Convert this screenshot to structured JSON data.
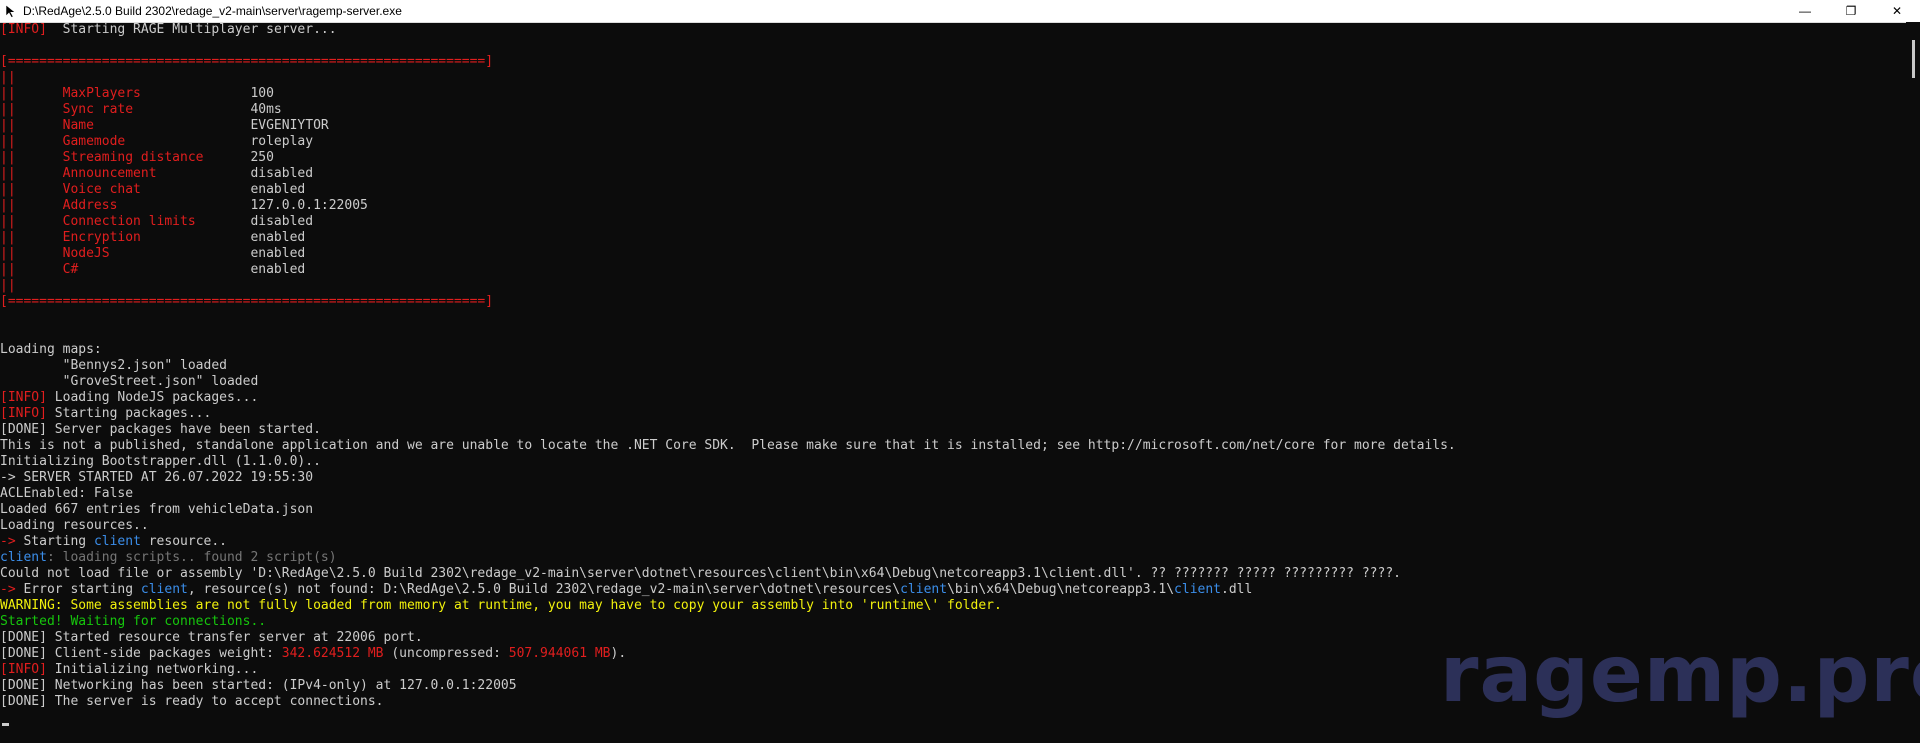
{
  "window": {
    "title": "D:\\RedAge\\2.5.0 Build 2302\\redage_v2-main\\server\\ragemp-server.exe",
    "minimize_glyph": "—",
    "maximize_glyph": "❐",
    "close_glyph": "✕",
    "icon": "cursor-arrow-icon"
  },
  "watermark": "ragemp.pro",
  "colors": {
    "background": "#0c0c0c",
    "text": "#cccccc",
    "red": "#e11e1e",
    "blue": "#3b8eea",
    "gray": "#767676",
    "yellow": "#f1f10c",
    "green": "#16c60c",
    "watermark": "#2c3058"
  },
  "console": {
    "lines": [
      [
        [
          "red",
          "[INFO]"
        ],
        [
          "",
          "  Starting RAGE Multiplayer server..."
        ]
      ],
      [],
      [
        [
          "red",
          "[=============================================================]"
        ]
      ],
      [
        [
          "red",
          "||"
        ]
      ],
      [
        [
          "red",
          "||      MaxPlayers              "
        ],
        [
          "",
          "100"
        ]
      ],
      [
        [
          "red",
          "||      Sync rate               "
        ],
        [
          "",
          "40ms"
        ]
      ],
      [
        [
          "red",
          "||      Name                    "
        ],
        [
          "",
          "EVGENIYTOR"
        ]
      ],
      [
        [
          "red",
          "||      Gamemode                "
        ],
        [
          "",
          "roleplay"
        ]
      ],
      [
        [
          "red",
          "||      Streaming distance      "
        ],
        [
          "",
          "250"
        ]
      ],
      [
        [
          "red",
          "||      Announcement            "
        ],
        [
          "",
          "disabled"
        ]
      ],
      [
        [
          "red",
          "||      Voice chat              "
        ],
        [
          "",
          "enabled"
        ]
      ],
      [
        [
          "red",
          "||      Address                 "
        ],
        [
          "",
          "127.0.0.1:22005"
        ]
      ],
      [
        [
          "red",
          "||      Connection limits       "
        ],
        [
          "",
          "disabled"
        ]
      ],
      [
        [
          "red",
          "||      Encryption              "
        ],
        [
          "",
          "enabled"
        ]
      ],
      [
        [
          "red",
          "||      NodeJS                  "
        ],
        [
          "",
          "enabled"
        ]
      ],
      [
        [
          "red",
          "||      C#                      "
        ],
        [
          "",
          "enabled"
        ]
      ],
      [
        [
          "red",
          "||"
        ]
      ],
      [
        [
          "red",
          "[=============================================================]"
        ]
      ],
      [],
      [],
      [
        [
          "",
          "Loading maps:"
        ]
      ],
      [
        [
          "",
          "        \"Bennys2.json\" loaded"
        ]
      ],
      [
        [
          "",
          "        \"GroveStreet.json\" loaded"
        ]
      ],
      [
        [
          "red",
          "[INFO]"
        ],
        [
          "",
          " Loading NodeJS packages..."
        ]
      ],
      [
        [
          "red",
          "[INFO]"
        ],
        [
          "",
          " Starting packages..."
        ]
      ],
      [
        [
          "",
          "[DONE] Server packages have been started."
        ]
      ],
      [
        [
          "",
          "This is not a published, standalone application and we are unable to locate the .NET Core SDK.  Please make sure that it is installed; see http://microsoft.com/net/core for more details."
        ]
      ],
      [
        [
          "",
          "Initializing Bootstrapper.dll (1.1.0.0).."
        ]
      ],
      [
        [
          "",
          "-> SERVER STARTED AT 26.07.2022 19:55:30"
        ]
      ],
      [
        [
          "",
          "ACLEnabled: False"
        ]
      ],
      [
        [
          "",
          "Loaded 667 entries from vehicleData.json"
        ]
      ],
      [
        [
          "",
          "Loading resources.."
        ]
      ],
      [
        [
          "red",
          "->"
        ],
        [
          "",
          " Starting "
        ],
        [
          "blue",
          "client"
        ],
        [
          "",
          " resource.."
        ]
      ],
      [
        [
          "blue",
          "client"
        ],
        [
          "gray",
          ": loading scripts.. found 2 script(s)"
        ]
      ],
      [
        [
          "",
          "Could not load file or assembly 'D:\\RedAge\\2.5.0 Build 2302\\redage_v2-main\\server\\dotnet\\resources\\client\\bin\\x64\\Debug\\netcoreapp3.1\\client.dll'. ?? ??????? ????? ????????? ????."
        ]
      ],
      [
        [
          "red",
          "->"
        ],
        [
          "",
          " Error starting "
        ],
        [
          "blue",
          "client"
        ],
        [
          "",
          ", resource(s) not found: D:\\RedAge\\2.5.0 Build 2302\\redage_v2-main\\server\\dotnet\\resources\\"
        ],
        [
          "blue",
          "client"
        ],
        [
          "",
          "\\bin\\x64\\Debug\\netcoreapp3.1\\"
        ],
        [
          "blue",
          "client"
        ],
        [
          "",
          ".dll"
        ]
      ],
      [
        [
          "yellow",
          "WARNING: Some assemblies are not fully loaded from memory at runtime, you may have to copy your assembly into 'runtime\\' folder."
        ]
      ],
      [
        [
          "green",
          "Started! Waiting for connections.."
        ]
      ],
      [
        [
          "",
          "[DONE] Started resource transfer server at 22006 port."
        ]
      ],
      [
        [
          "",
          "[DONE] Client-side packages weight: "
        ],
        [
          "red",
          "342.624512 MB"
        ],
        [
          "",
          " (uncompressed: "
        ],
        [
          "red",
          "507.944061 MB"
        ],
        [
          "",
          "). "
        ]
      ],
      [
        [
          "red",
          "[INFO]"
        ],
        [
          "",
          " Initializing networking..."
        ]
      ],
      [
        [
          "",
          "[DONE] Networking has been started: (IPv4-only) at 127.0.0.1:22005"
        ]
      ],
      [
        [
          "",
          "[DONE] The server is ready to accept connections."
        ]
      ]
    ]
  }
}
